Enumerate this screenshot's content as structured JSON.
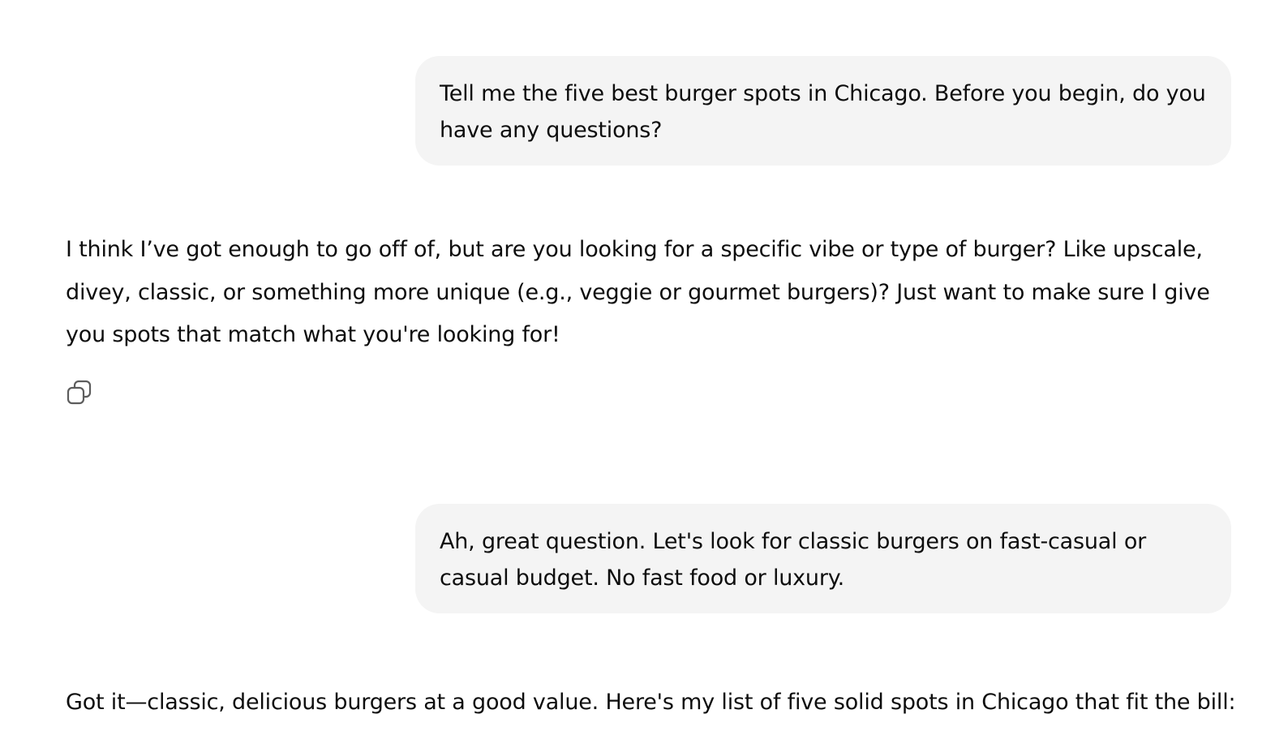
{
  "conversation": {
    "messages": [
      {
        "role": "user",
        "text": "Tell me the five best burger spots in Chicago. Before you begin, do you have any questions?"
      },
      {
        "role": "assistant",
        "text": "I think I’ve got enough to go off of, but are you looking for a specific vibe or type of burger? Like upscale, divey, classic, or something more unique (e.g., veggie or gourmet burgers)? Just want to make sure I give you spots that match what you're looking for!",
        "actions": {
          "copy_icon": "copy-icon"
        }
      },
      {
        "role": "user",
        "text": "Ah, great question. Let's look for classic burgers on fast-casual or casual budget. No fast food or luxury."
      },
      {
        "role": "assistant",
        "text": "Got it—classic, delicious burgers at a good value. Here's my list of five solid spots in Chicago that fit the bill:"
      }
    ]
  },
  "colors": {
    "user_bubble_bg": "#f4f4f4",
    "text": "#0d0d0d",
    "icon": "#5d5d5d"
  }
}
